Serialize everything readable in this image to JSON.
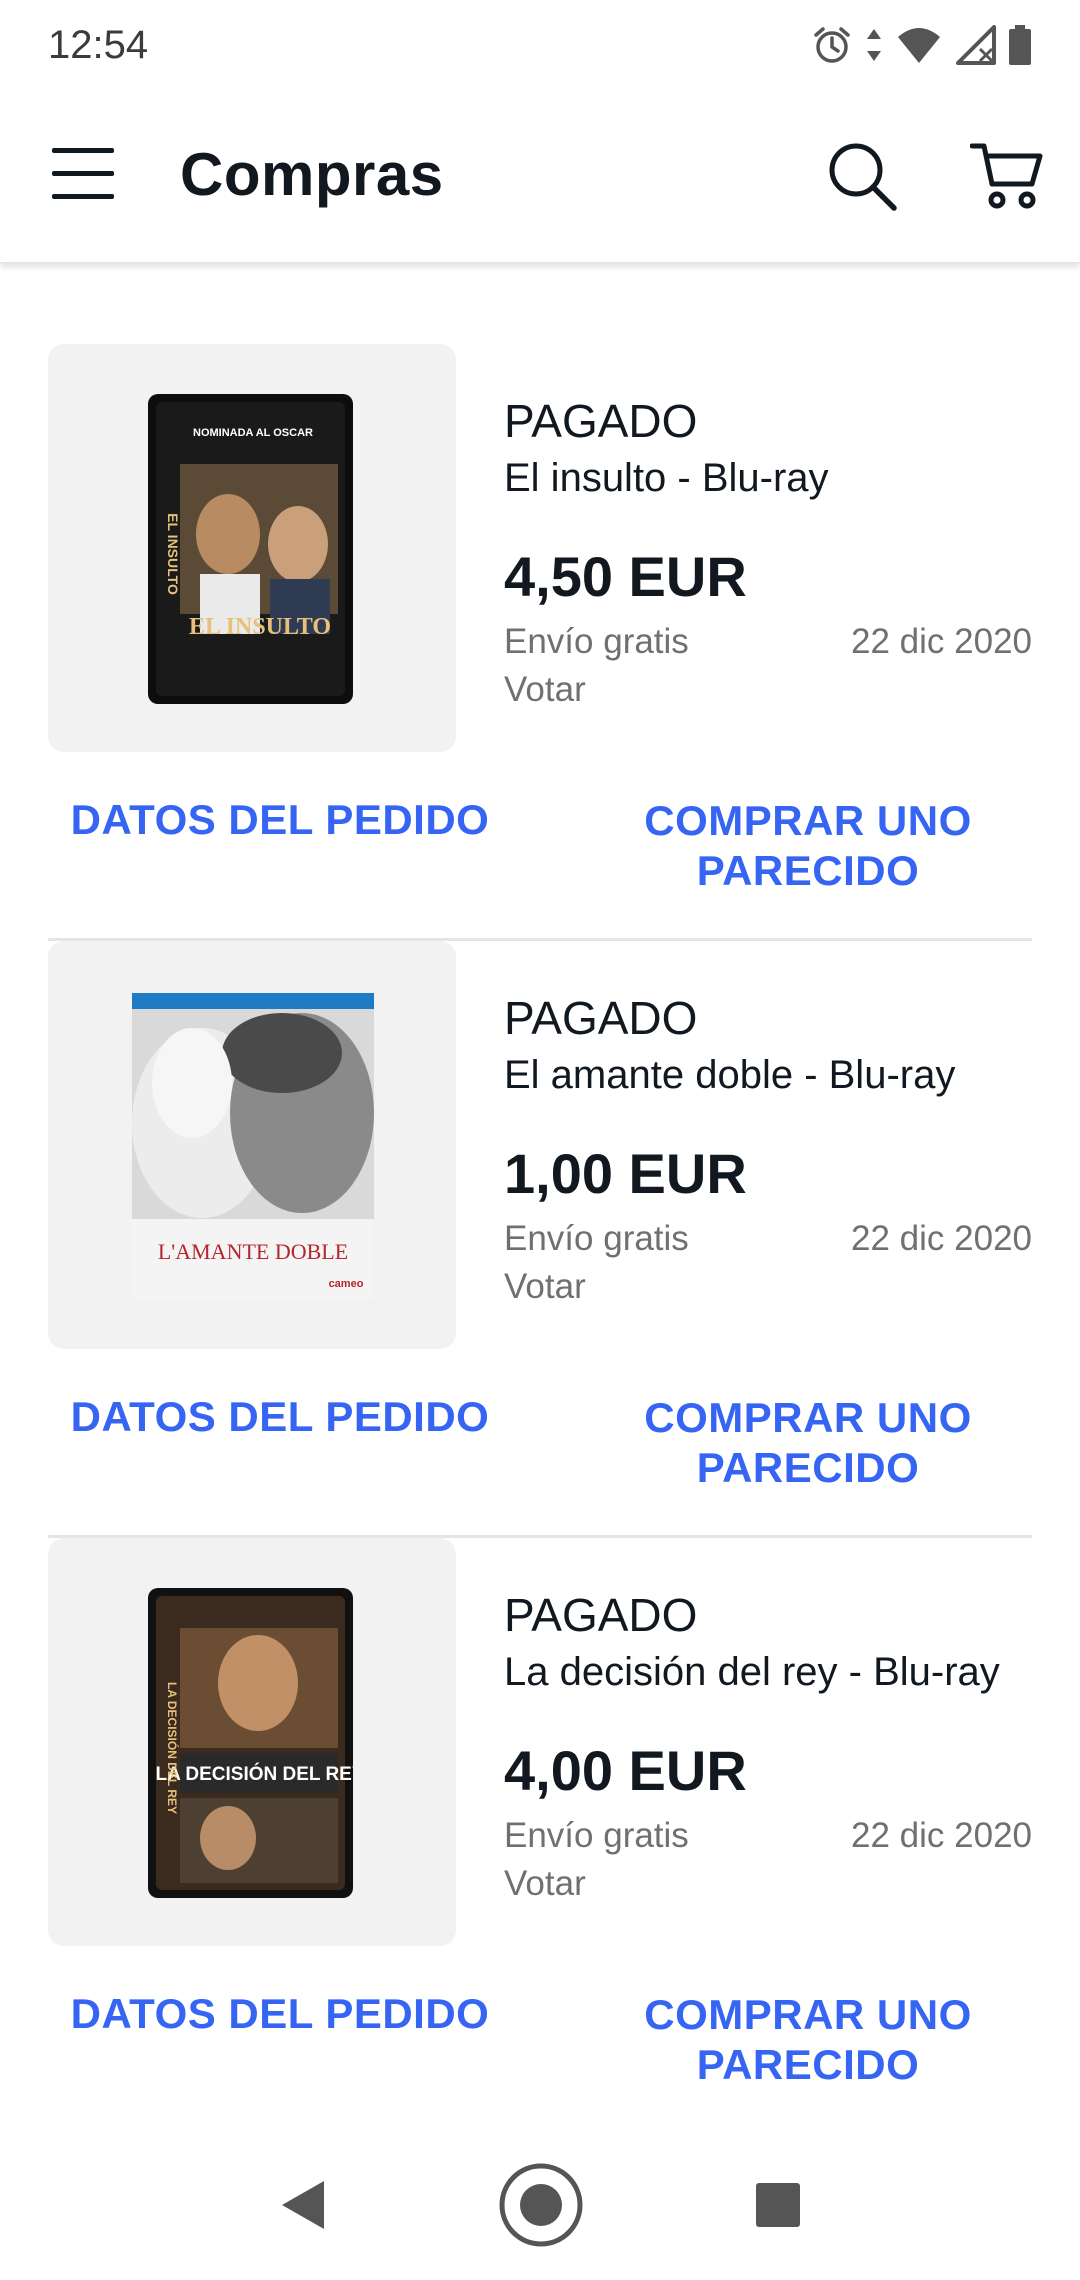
{
  "status_bar": {
    "time": "12:54",
    "icons": [
      "alarm-icon",
      "data-arrows-icon",
      "wifi-icon",
      "signal-icon",
      "battery-icon"
    ]
  },
  "app_bar": {
    "title": "Compras",
    "icons": [
      "menu-icon",
      "search-icon",
      "cart-icon"
    ]
  },
  "colors": {
    "accent": "#3665f3",
    "text_primary": "#111820",
    "text_secondary": "#707070",
    "divider": "#e5e5e5",
    "thumb_bg": "#f2f2f2"
  },
  "orders": [
    {
      "status": "PAGADO",
      "title": "El insulto - Blu-ray",
      "price": "4,50 EUR",
      "shipping": "Envío gratis",
      "date": "22 dic 2020",
      "vote": "Votar",
      "action_details": "DATOS DEL PEDIDO",
      "action_similar": "COMPRAR UNO PARECIDO",
      "cover": {
        "title_text": "EL INSULTO",
        "side_text": "EL INSULTO",
        "top_text": "NOMINADA AL OSCAR"
      }
    },
    {
      "status": "PAGADO",
      "title": "El amante doble - Blu-ray",
      "price": "1,00 EUR",
      "shipping": "Envío gratis",
      "date": "22 dic 2020",
      "vote": "Votar",
      "action_details": "DATOS DEL PEDIDO",
      "action_similar": "COMPRAR UNO PARECIDO",
      "cover": {
        "title_text": "L'AMANTE DOBLE",
        "brand_text": "cameo"
      }
    },
    {
      "status": "PAGADO",
      "title": "La decisión del rey - Blu-ray",
      "price": "4,00 EUR",
      "shipping": "Envío gratis",
      "date": "22 dic 2020",
      "vote": "Votar",
      "action_details": "DATOS DEL PEDIDO",
      "action_similar": "COMPRAR UNO PARECIDO",
      "cover": {
        "title_text": "LA DECISIÓN DEL REY",
        "side_text": "LA DECISIÓN DEL REY"
      }
    }
  ],
  "nav_bar": {
    "buttons": [
      "back-icon",
      "home-icon",
      "recents-icon"
    ]
  }
}
